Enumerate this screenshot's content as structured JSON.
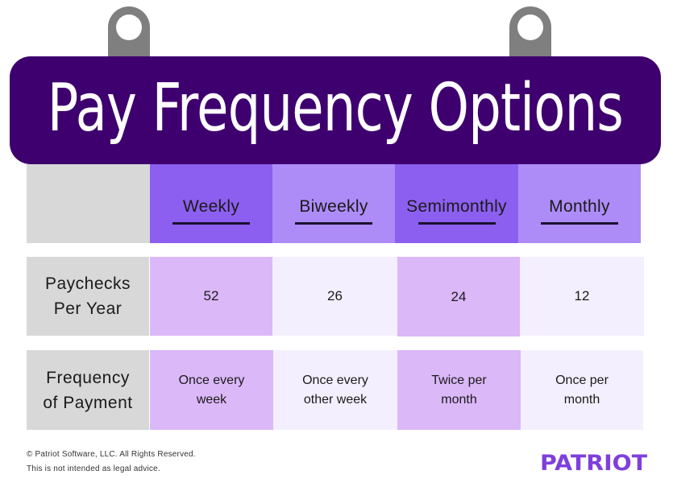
{
  "title": "Pay Frequency Options",
  "colors": {
    "banner": "#3f006f",
    "hanger": "#7f7f7f",
    "header_dark": "#8d5ff0",
    "header_mid": "#ae8cf8",
    "cell_lavender": "#dbb8f8",
    "cell_pale": "#f4effe",
    "label_gray": "#d8d8d8",
    "logo": "#7f3fdc"
  },
  "table": {
    "columns": [
      "Weekly",
      "Biweekly",
      "Semimonthly",
      "Monthly"
    ],
    "rows": [
      {
        "label_line1": "Paychecks",
        "label_line2": "Per Year",
        "values": [
          "52",
          "26",
          "24",
          "12"
        ]
      },
      {
        "label_line1": "Frequency",
        "label_line2": "of Payment",
        "values": [
          [
            "Once every",
            "week"
          ],
          [
            "Once every",
            "other week"
          ],
          [
            "Twice per",
            "month"
          ],
          [
            "Once per",
            "month"
          ]
        ]
      }
    ]
  },
  "footer": {
    "copyright": "© Patriot Software, LLC. All Rights Reserved.",
    "disclaimer": "This is not intended as legal advice."
  },
  "logo": "PATRIOT"
}
